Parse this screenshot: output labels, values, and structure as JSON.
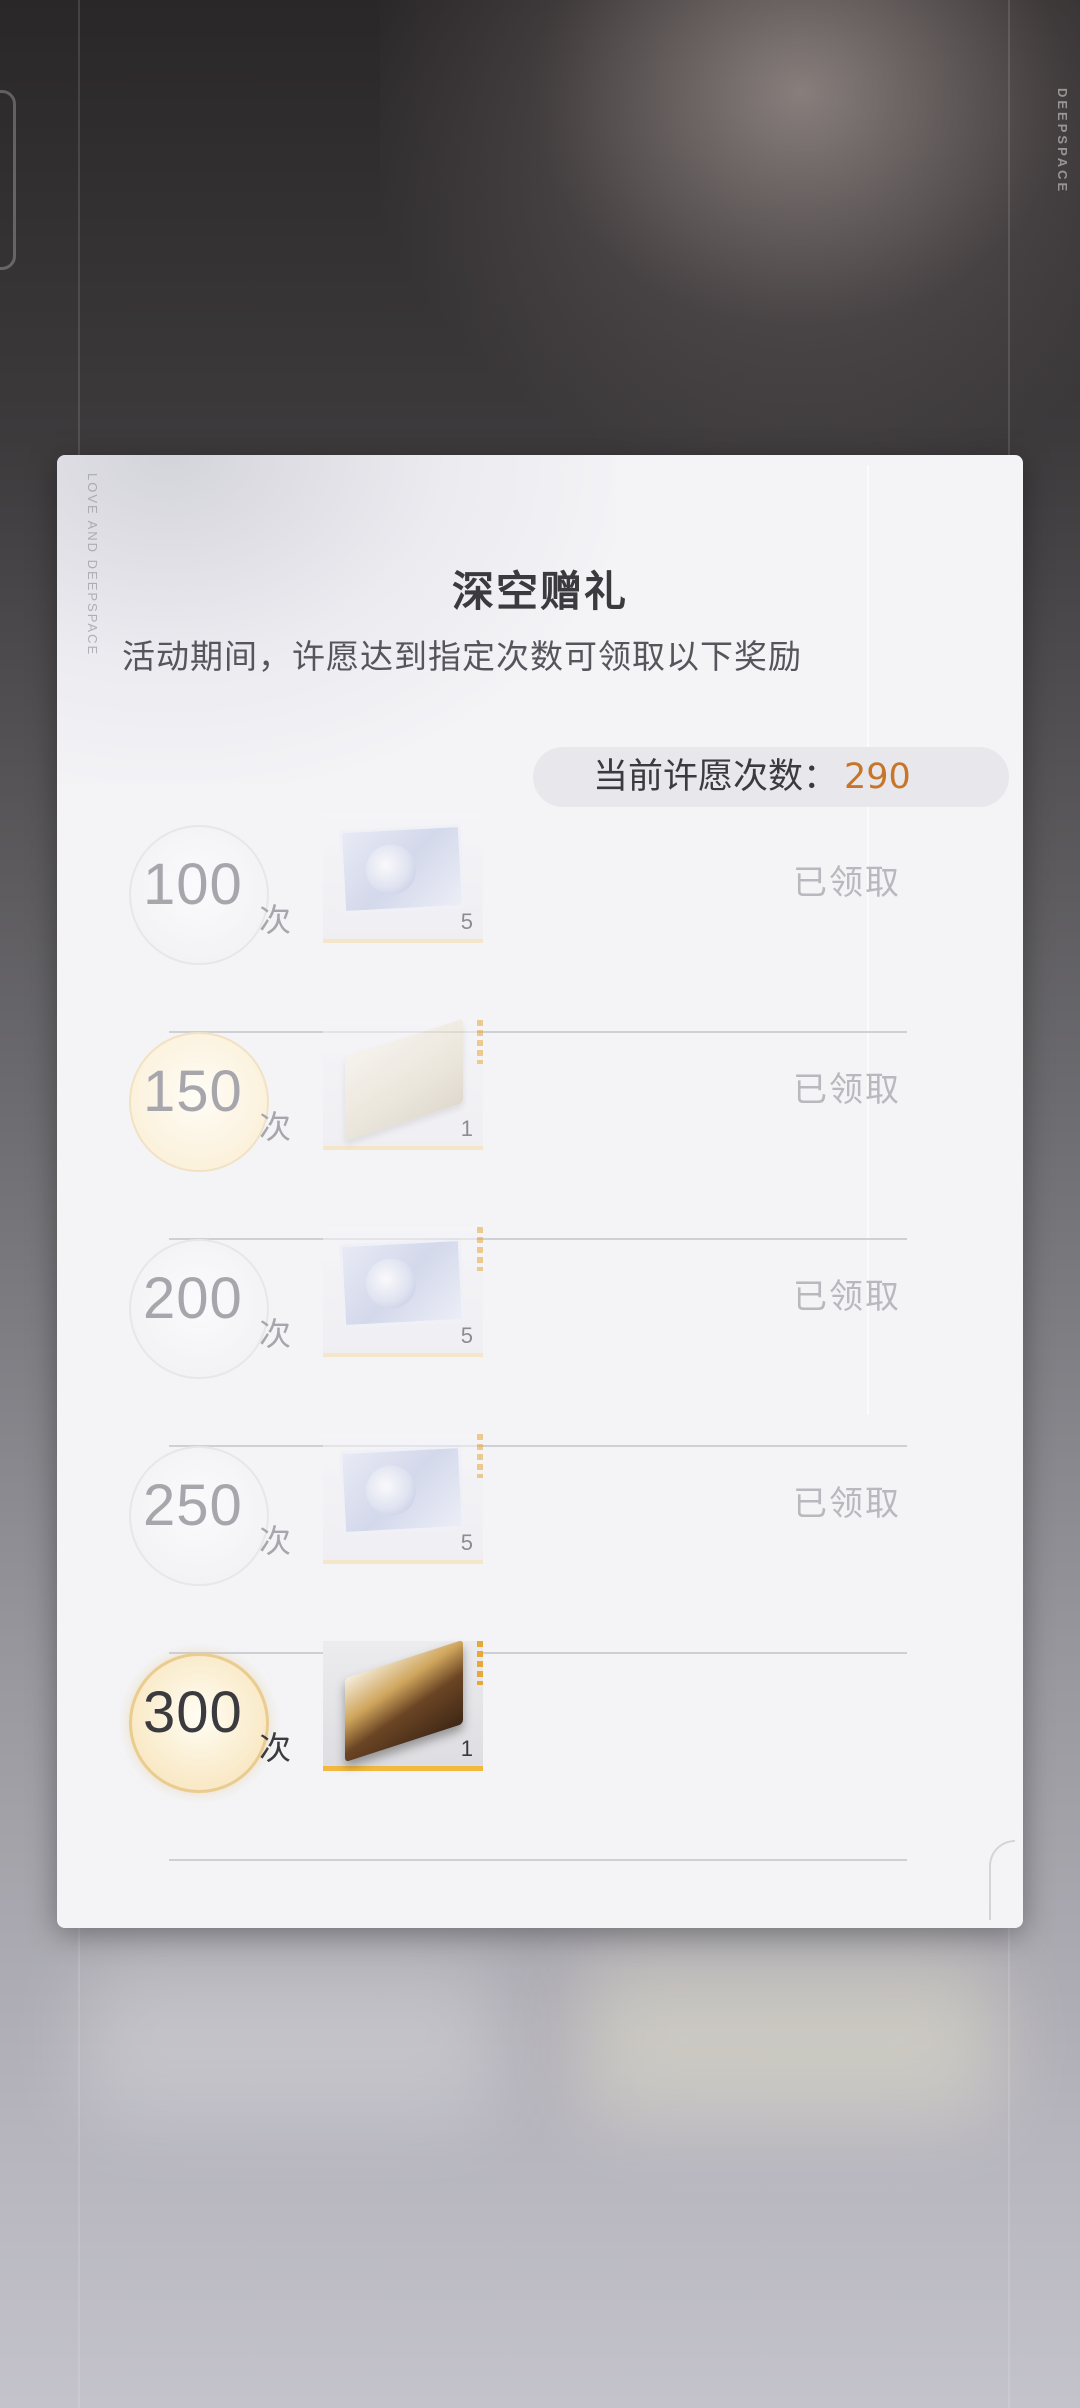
{
  "background": {
    "brand_vertical": "DEEPSPACE",
    "panel_side_text": "LOVE AND DEEPSPACE"
  },
  "panel": {
    "title": "深空赠礼",
    "subtitle": "活动期间，许愿达到指定次数可领取以下奖励",
    "wish_count_label": "当前许愿次数：",
    "wish_count_value": "290"
  },
  "unit": "次",
  "rewards": [
    {
      "milestone": "100",
      "unit": "次",
      "item": "ticket-icon",
      "qty": "5",
      "status": "已领取"
    },
    {
      "milestone": "150",
      "unit": "次",
      "item": "gift-box-icon",
      "qty": "1",
      "status": "已领取"
    },
    {
      "milestone": "200",
      "unit": "次",
      "item": "ticket-icon",
      "qty": "5",
      "status": "已领取"
    },
    {
      "milestone": "250",
      "unit": "次",
      "item": "ticket-icon",
      "qty": "5",
      "status": "已领取"
    },
    {
      "milestone": "300",
      "unit": "次",
      "item": "premium-box-icon",
      "qty": "1",
      "status": ""
    }
  ],
  "colors": {
    "accent_count": "#c8752a",
    "rarity_gold": "#f2b93e",
    "claimed_text": "#b9b8be"
  }
}
